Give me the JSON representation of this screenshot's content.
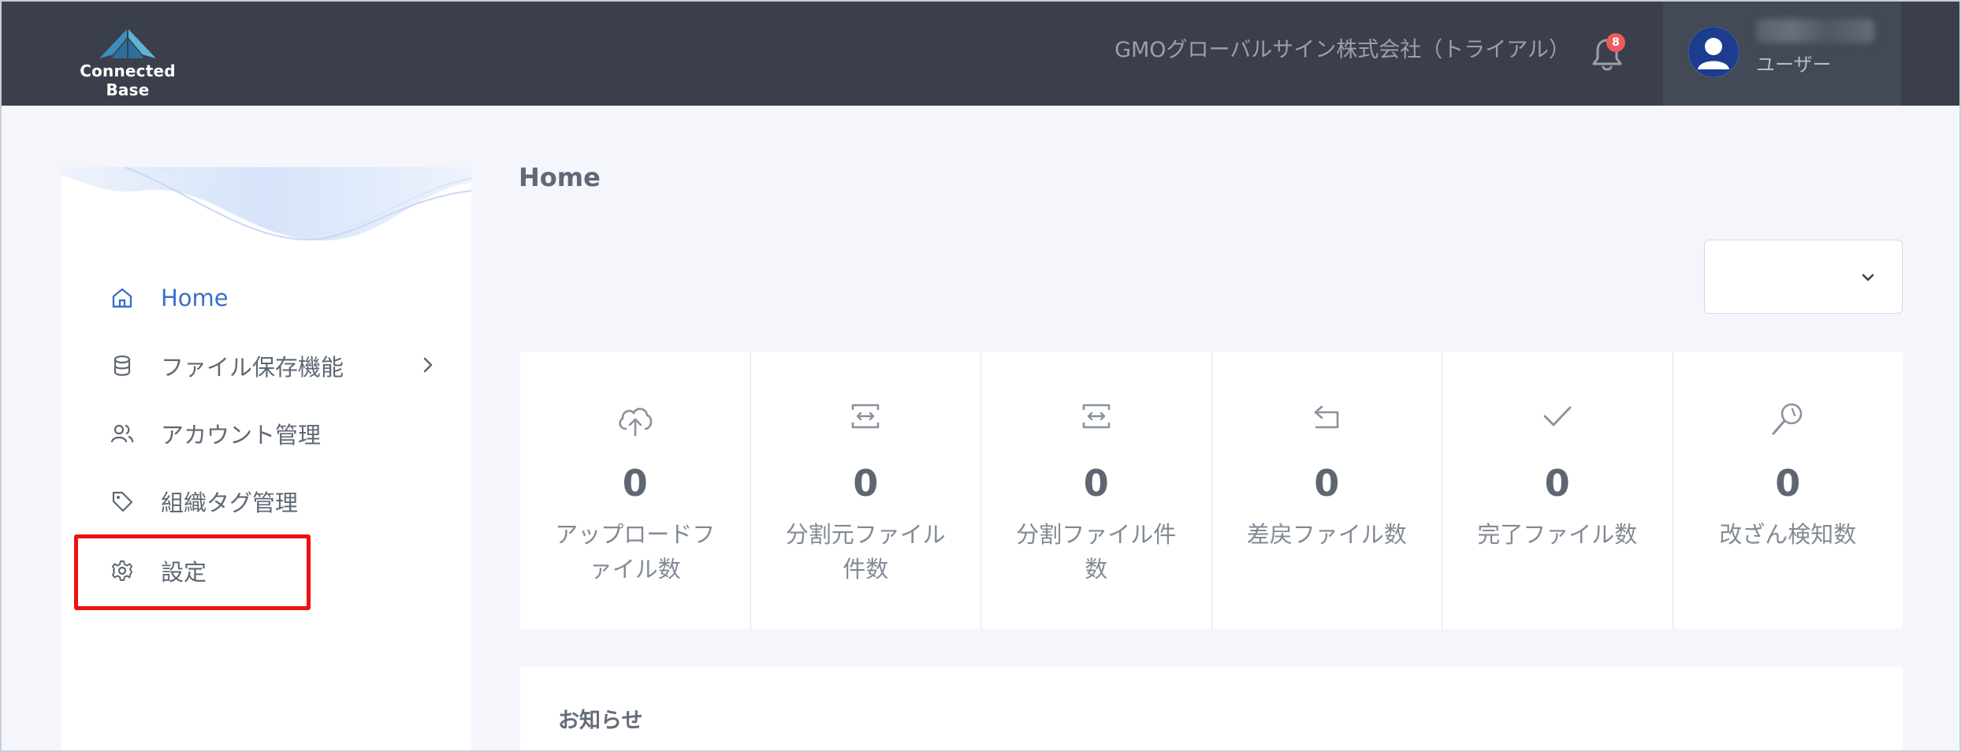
{
  "header": {
    "logo_text": "Connected Base",
    "company_name": "GMOグローバルサイン株式会社（トライアル）",
    "notification_count": "8",
    "user_role": "ユーザー"
  },
  "sidebar": {
    "items": [
      {
        "label": "Home",
        "icon": "home-icon",
        "active": true
      },
      {
        "label": "ファイル保存機能",
        "icon": "database-icon",
        "has_submenu": true
      },
      {
        "label": "アカウント管理",
        "icon": "users-icon"
      },
      {
        "label": "組織タグ管理",
        "icon": "tag-icon"
      },
      {
        "label": "設定",
        "icon": "gear-icon",
        "highlighted": true
      }
    ]
  },
  "main": {
    "page_title": "Home",
    "period_select_value": "",
    "stats": [
      {
        "value": "0",
        "label": "アップロードファイル数",
        "icon": "cloud-upload-icon"
      },
      {
        "value": "0",
        "label": "分割元ファイル件数",
        "icon": "split-source-icon"
      },
      {
        "value": "0",
        "label": "分割ファイル件数",
        "icon": "split-file-icon"
      },
      {
        "value": "0",
        "label": "差戻ファイル数",
        "icon": "return-icon"
      },
      {
        "value": "0",
        "label": "完了ファイル数",
        "icon": "check-icon"
      },
      {
        "value": "0",
        "label": "改ざん検知数",
        "icon": "tamper-detect-icon"
      }
    ],
    "notice_title": "お知らせ"
  },
  "colors": {
    "topbar": "#3a3f4b",
    "active_nav": "#3c6fc7",
    "highlight": "#ee1111",
    "badge": "#ef5a5a"
  }
}
